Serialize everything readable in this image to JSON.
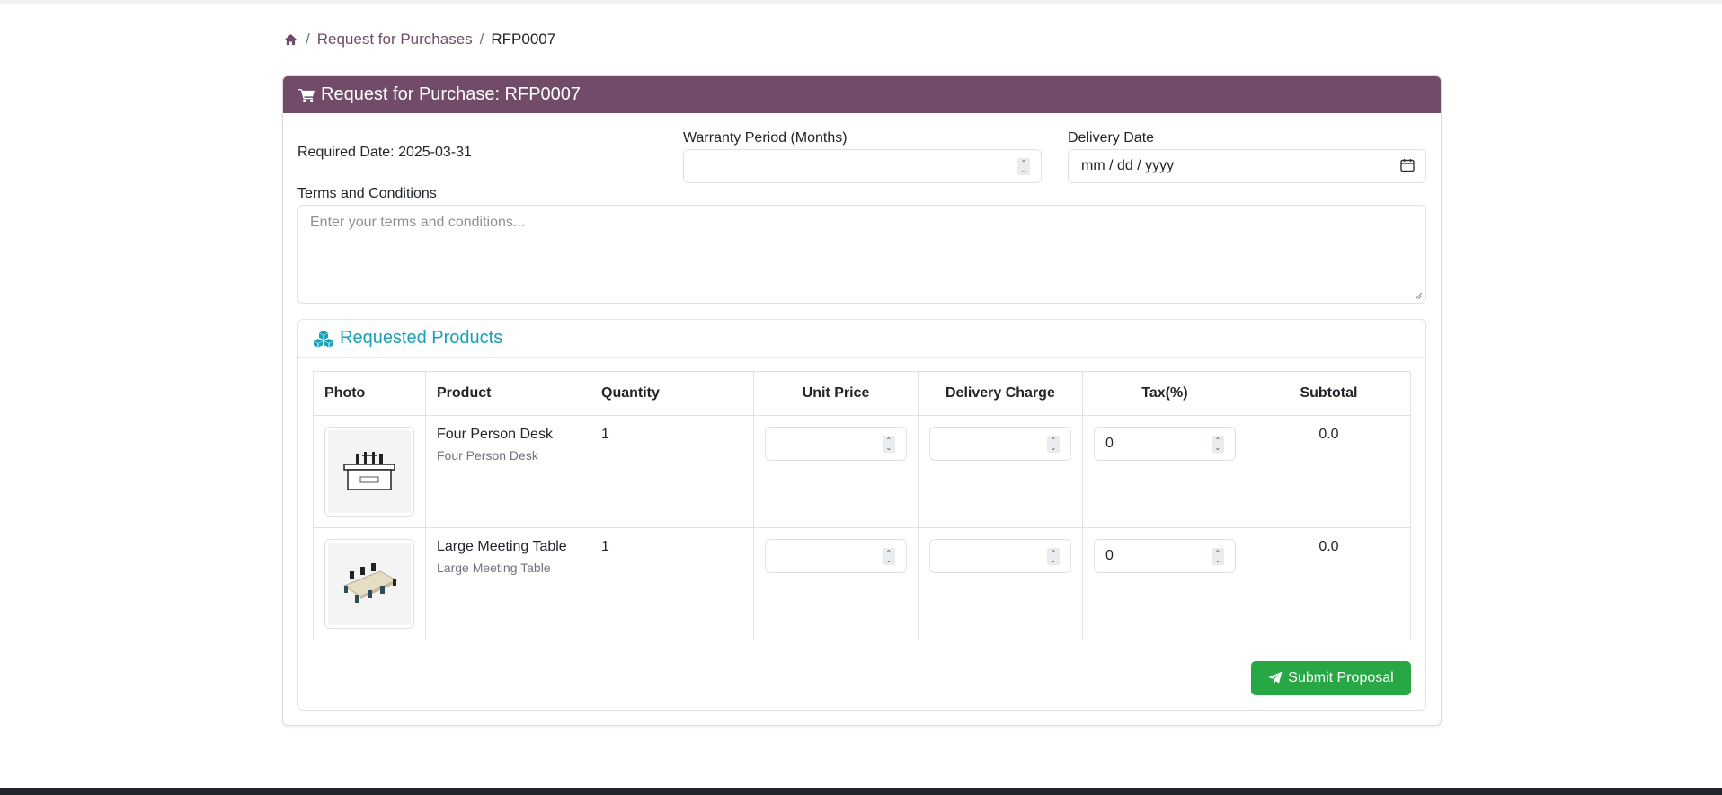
{
  "breadcrumb": {
    "items": [
      "Request for Purchases"
    ],
    "current": "RFP0007"
  },
  "card": {
    "title": "Request for Purchase: RFP0007",
    "required_date": "Required Date: 2025-03-31",
    "warranty_label": "Warranty Period (Months)",
    "warranty_value": "",
    "delivery_label": "Delivery Date",
    "delivery_placeholder": "mm / dd / yyyy",
    "terms_label": "Terms and Conditions",
    "terms_placeholder": "Enter your terms and conditions..."
  },
  "products": {
    "title": "Requested Products",
    "columns": [
      "Photo",
      "Product",
      "Quantity",
      "Unit Price",
      "Delivery Charge",
      "Tax(%)",
      "Subtotal"
    ],
    "rows": [
      {
        "name": "Four Person Desk",
        "subtitle": "Four Person Desk",
        "quantity": "1",
        "unit_price": "",
        "delivery_charge": "",
        "tax": "0",
        "subtotal": "0.0",
        "image": "desk-image"
      },
      {
        "name": "Large Meeting Table",
        "subtitle": "Large Meeting Table",
        "quantity": "1",
        "unit_price": "",
        "delivery_charge": "",
        "tax": "0",
        "subtotal": "0.0",
        "image": "meeting-table-image"
      }
    ],
    "submit_label": "Submit Proposal"
  },
  "colors": {
    "brand": "#714b67",
    "accent": "#17a2b8",
    "success": "#28a745"
  }
}
